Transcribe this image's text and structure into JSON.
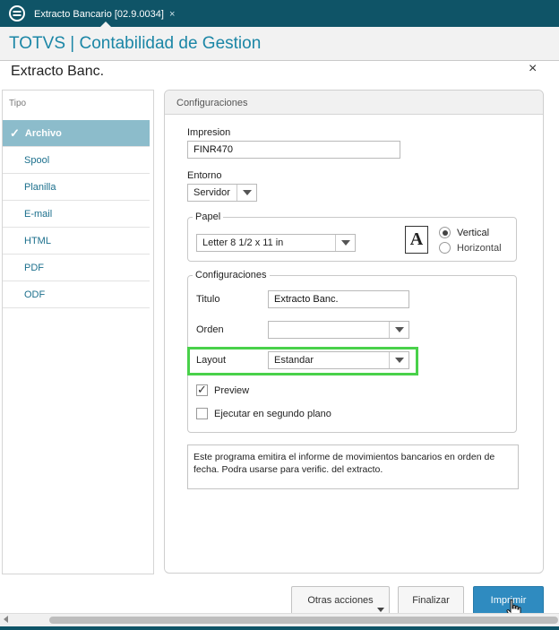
{
  "tab": {
    "title": "Extracto Bancario [02.9.0034]",
    "close_icon": "×"
  },
  "app": {
    "title": "TOTVS | Contabilidad de Gestion"
  },
  "dialog": {
    "title": "Extracto Banc.",
    "close_icon": "×"
  },
  "tipo": {
    "label": "Tipo",
    "items": [
      {
        "label": "Archivo",
        "selected": true
      },
      {
        "label": "Spool"
      },
      {
        "label": "Planilla"
      },
      {
        "label": "E-mail"
      },
      {
        "label": "HTML"
      },
      {
        "label": "PDF"
      },
      {
        "label": "ODF"
      }
    ]
  },
  "config": {
    "title": "Configuraciones",
    "impresion": {
      "label": "Impresion",
      "value": "FINR470"
    },
    "entorno": {
      "label": "Entorno",
      "value": "Servidor"
    },
    "papel": {
      "legend": "Papel",
      "size": "Letter 8 1/2 x 11 in",
      "orientation_icon_letter": "A",
      "vertical": "Vertical",
      "horizontal": "Horizontal",
      "selected": "Vertical"
    },
    "group": {
      "legend": "Configuraciones",
      "titulo_label": "Titulo",
      "titulo_value": "Extracto Banc.",
      "orden_label": "Orden",
      "orden_value": "",
      "layout_label": "Layout",
      "layout_value": "Estandar",
      "preview_label": "Preview",
      "preview_checked": true,
      "segundo_label": "Ejecutar en segundo plano",
      "segundo_checked": false
    },
    "description": "Este programa emitira el informe de movimientos bancarios en orden de fecha. Podra usarse para  verific. del extracto."
  },
  "footer": {
    "otras": "Otras acciones",
    "finalizar": "Finalizar",
    "imprimir": "Imprimir"
  },
  "colors": {
    "topbar": "#0f5467",
    "accent": "#1b86a6",
    "selected": "#8cbccb",
    "primary_button": "#2f8bc0",
    "highlight": "#49d14a"
  }
}
